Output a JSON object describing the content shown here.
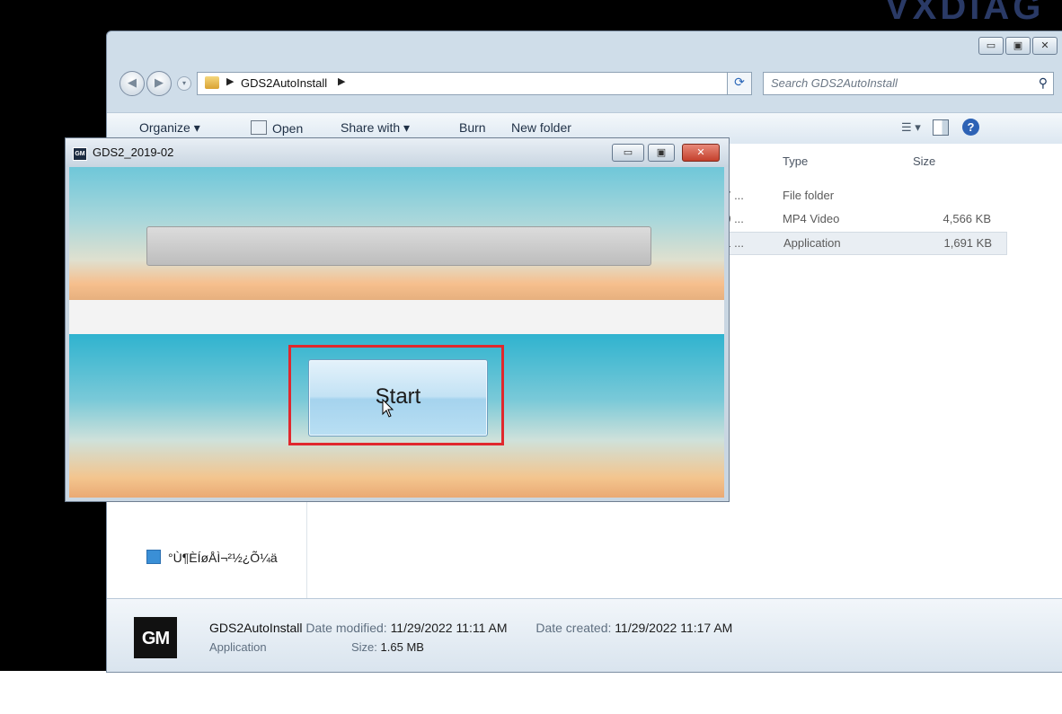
{
  "brand_text": "VXDIAG",
  "explorer": {
    "address_path": "GDS2AutoInstall",
    "search_placeholder": "Search GDS2AutoInstall",
    "window_controls": {
      "minimize": "▭",
      "maximize": "▣",
      "close": "✕"
    },
    "toolbar": {
      "organize": "Organize ▾",
      "open": "Open",
      "share_with": "Share with ▾",
      "burn": "Burn",
      "new_folder": "New folder"
    },
    "columns": {
      "type": "Type",
      "size": "Size"
    },
    "files": [
      {
        "date": "17 ...",
        "type": "File folder",
        "size": ""
      },
      {
        "date": "10 ...",
        "type": "MP4 Video",
        "size": "4,566 KB"
      },
      {
        "date": "11 ...",
        "type": "Application",
        "size": "1,691 KB"
      }
    ],
    "nav_item": "°Ù¶ÈÍøÅÌ¬²½¿Õ¼ä",
    "details": {
      "logo": "GM",
      "name": "GDS2AutoInstall",
      "date_modified_label": "Date modified:",
      "date_modified": "11/29/2022 11:11 AM",
      "date_created_label": "Date created:",
      "date_created": "11/29/2022 11:17 AM",
      "kind": "Application",
      "size_label": "Size:",
      "size": "1.65 MB"
    }
  },
  "dialog": {
    "title": "GDS2_2019-02",
    "icon_text": "GM",
    "start_label": "Start",
    "progress": 0
  }
}
